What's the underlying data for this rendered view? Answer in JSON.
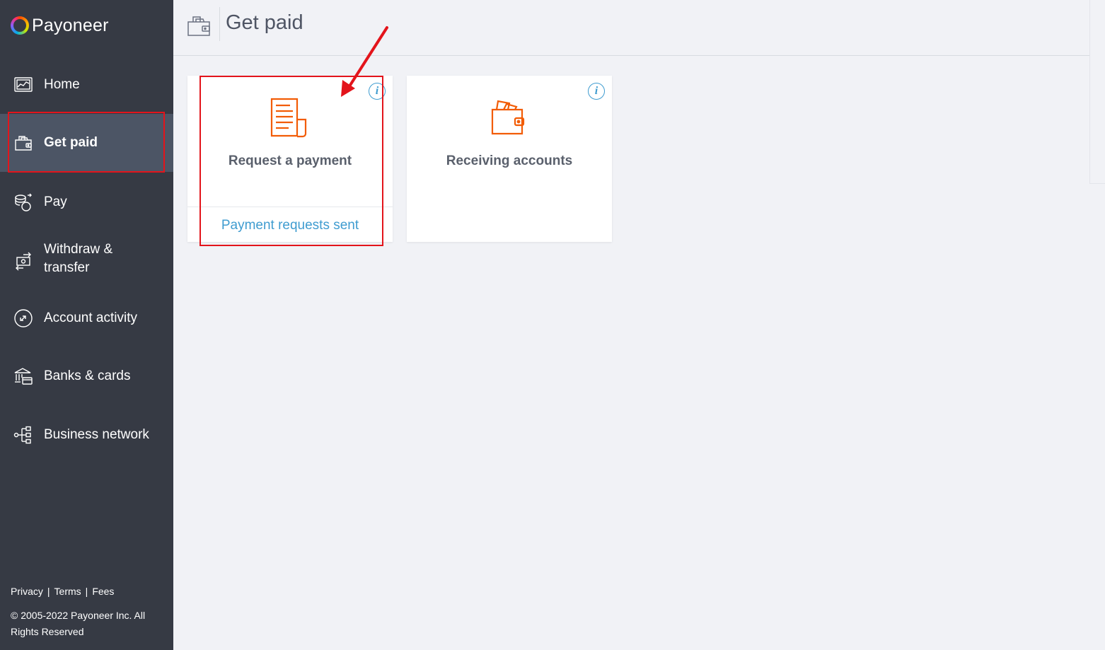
{
  "brand": {
    "name": "Payoneer"
  },
  "sidebar": {
    "items": [
      {
        "label": "Home",
        "icon": "chart-screen-icon",
        "active": false
      },
      {
        "label": "Get paid",
        "icon": "wallet-icon",
        "active": true
      },
      {
        "label": "Pay",
        "icon": "coins-icon",
        "active": false
      },
      {
        "label": "Withdraw & transfer",
        "line1": "Withdraw &",
        "line2": "transfer",
        "icon": "transfer-icon",
        "active": false
      },
      {
        "label": "Account activity",
        "icon": "activity-icon",
        "active": false
      },
      {
        "label": "Banks & cards",
        "icon": "bank-icon",
        "active": false
      },
      {
        "label": "Business network",
        "icon": "network-icon",
        "active": false
      }
    ],
    "footer": {
      "privacy": "Privacy",
      "sep": "|",
      "terms": "Terms",
      "fees": "Fees",
      "copyright": "© 2005-2022 Payoneer Inc. All Rights Reserved"
    }
  },
  "header": {
    "title": "Get paid",
    "icon": "wallet-icon"
  },
  "cards": [
    {
      "title": "Request a payment",
      "icon": "invoice-icon",
      "link": "Payment requests sent",
      "info": "i"
    },
    {
      "title": "Receiving accounts",
      "icon": "wallet-cards-icon",
      "info": "i"
    }
  ],
  "colors": {
    "sidebar_bg": "#363a44",
    "sidebar_active": "#4c5565",
    "accent_orange": "#f25c05",
    "link_blue": "#3f9cd0",
    "annotation_red": "#e3141b"
  }
}
